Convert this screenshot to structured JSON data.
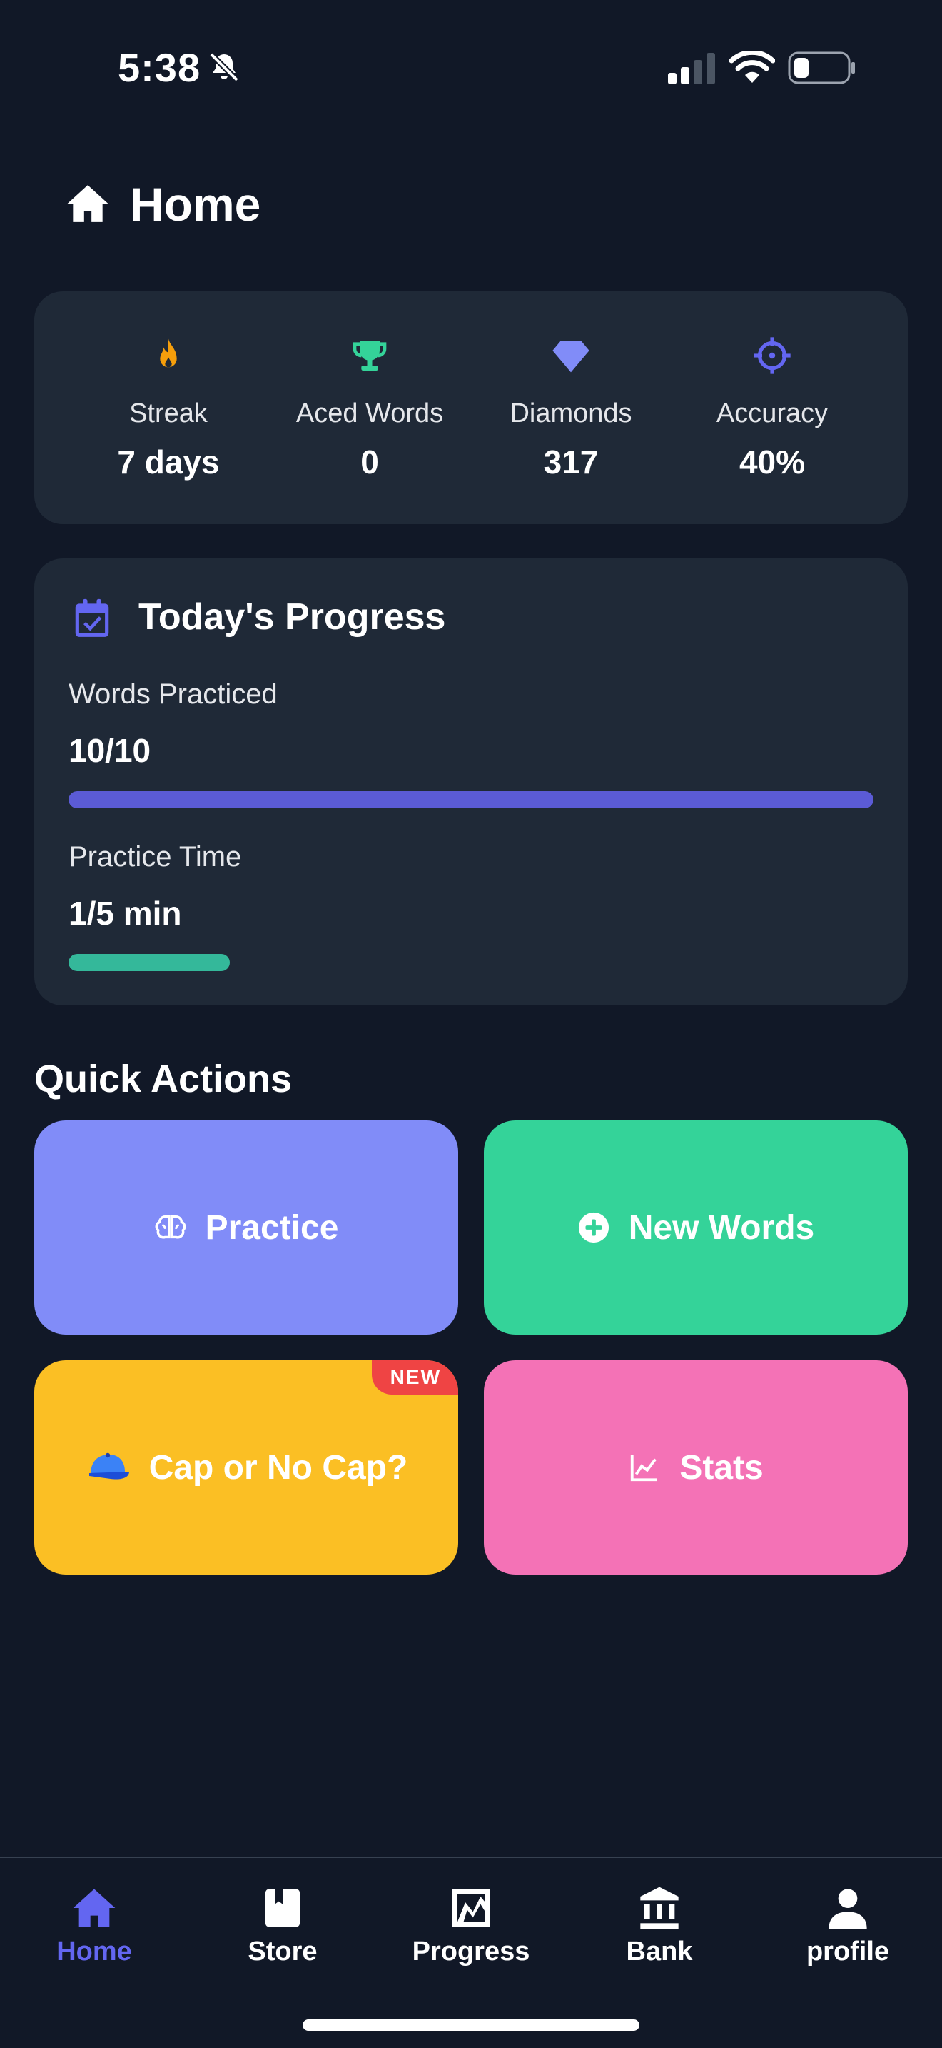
{
  "status_bar": {
    "time": "5:38",
    "icons": [
      "bell-slash-icon",
      "signal-icon",
      "wifi-icon",
      "battery-icon"
    ]
  },
  "header": {
    "title": "Home",
    "icon": "home-icon"
  },
  "stats": [
    {
      "label": "Streak",
      "value": "7 days",
      "icon": "flame-icon",
      "color": "#f59e0b"
    },
    {
      "label": "Aced Words",
      "value": "0",
      "icon": "trophy-icon",
      "color": "#34d399"
    },
    {
      "label": "Diamonds",
      "value": "317",
      "icon": "diamond-icon",
      "color": "#818cf8"
    },
    {
      "label": "Accuracy",
      "value": "40%",
      "icon": "crosshair-icon",
      "color": "#6366f1"
    }
  ],
  "todays_progress": {
    "title": "Today's Progress",
    "icon": "calendar-check-icon",
    "items": [
      {
        "label": "Words Practiced",
        "value": "10/10",
        "fraction": 1.0,
        "color": "#5b5bd6"
      },
      {
        "label": "Practice Time",
        "value": "1/5 min",
        "fraction": 0.2,
        "color": "#34b89a"
      }
    ]
  },
  "quick_actions": {
    "title": "Quick Actions",
    "buttons": [
      {
        "label": "Practice",
        "icon": "brain-icon",
        "color": "#818cf8"
      },
      {
        "label": "New Words",
        "icon": "plus-circle-icon",
        "color": "#34d399"
      },
      {
        "label": "Cap or No Cap?",
        "icon": "cap-icon",
        "color": "#fbbf24",
        "badge": "NEW"
      },
      {
        "label": "Stats",
        "icon": "chart-line-icon",
        "color": "#f472b6"
      }
    ]
  },
  "bottom_nav": {
    "active_color": "#6366f1",
    "items": [
      {
        "label": "Home",
        "icon": "home-icon",
        "active": true
      },
      {
        "label": "Store",
        "icon": "book-icon",
        "active": false
      },
      {
        "label": "Progress",
        "icon": "progress-chart-icon",
        "active": false
      },
      {
        "label": "Bank",
        "icon": "bank-icon",
        "active": false
      },
      {
        "label": "profile",
        "icon": "person-icon",
        "active": false
      }
    ]
  }
}
